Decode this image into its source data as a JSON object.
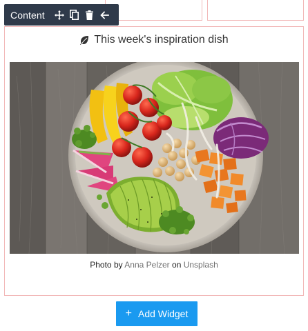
{
  "toolbar": {
    "label": "Content",
    "icons": [
      "move-icon",
      "duplicate-icon",
      "trash-icon",
      "arrow-left-icon"
    ]
  },
  "widget": {
    "title": "This week's inspiration dish",
    "title_icon": "leaf-icon",
    "image_alt": "Salad bowl",
    "caption": {
      "prefix": "Photo by",
      "author": "Anna Pelzer",
      "middle": "on",
      "source": "Unsplash"
    }
  },
  "add_widget": {
    "icon": "plus-icon",
    "label": "Add Widget"
  },
  "colors": {
    "toolbar_bg": "#2f3a4a",
    "border": "#f2b8b8",
    "button_bg": "#1a9af0"
  }
}
